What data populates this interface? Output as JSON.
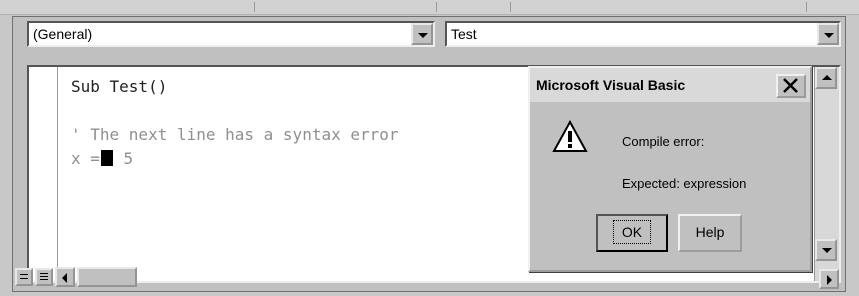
{
  "object_dropdown": {
    "value": "(General)"
  },
  "procedure_dropdown": {
    "value": "Test"
  },
  "code": {
    "line1": "Sub Test()",
    "line2": "' The next line has a syntax error",
    "line3_before": "x =",
    "line3_after": " 5"
  },
  "dialog": {
    "title": "Microsoft Visual Basic",
    "message1": "Compile error:",
    "message2": "Expected: expression",
    "ok_label": "OK",
    "help_label": "Help"
  }
}
